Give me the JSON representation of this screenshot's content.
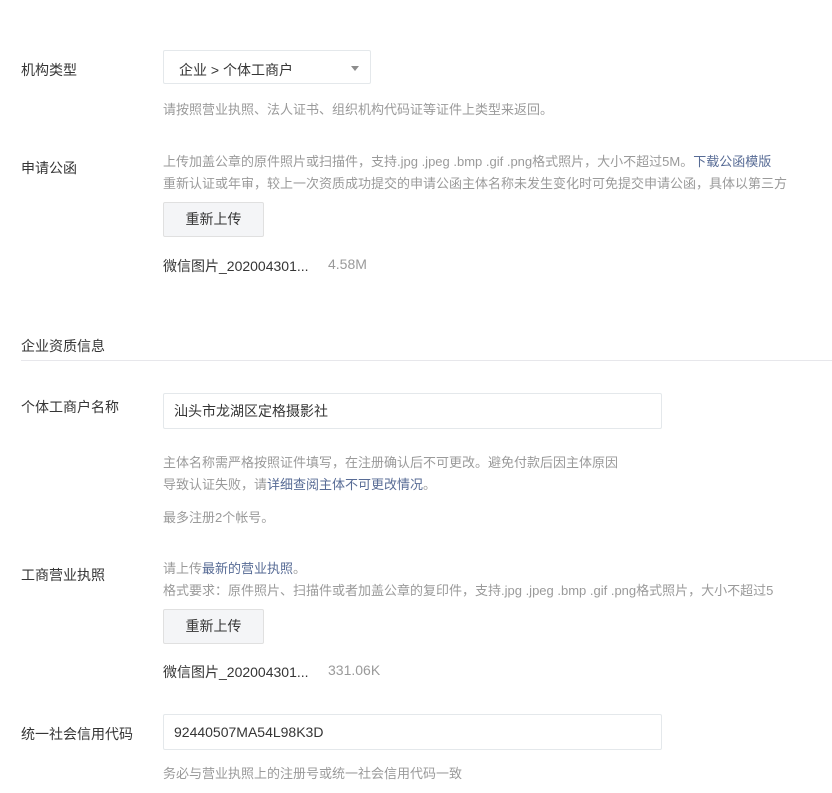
{
  "org_type": {
    "label": "机构类型",
    "value": "企业 > 个体工商户",
    "hint": "请按照营业执照、法人证书、组织机构代码证等证件上类型来返回。"
  },
  "application_letter": {
    "label": "申请公函",
    "hint_line1": "上传加盖公章的原件照片或扫描件，支持.jpg .jpeg .bmp .gif .png格式照片，大小不超过5M。",
    "download_link": "下载公函模版",
    "hint_line2": "重新认证或年审，较上一次资质成功提交的申请公函主体名称未发生变化时可免提交申请公函，具体以第三方",
    "reupload_button": "重新上传",
    "file_name": "微信图片_202004301...",
    "file_size": "4.58M"
  },
  "section": {
    "title": "企业资质信息"
  },
  "business_name": {
    "label": "个体工商户名称",
    "value": "汕头市龙湖区定格摄影社",
    "hint_line1": "主体名称需严格按照证件填写，在注册确认后不可更改。避免付款后因主体原因",
    "hint_line2_prefix": "导致认证失败，请",
    "hint_line2_link": "详细查阅主体不可更改情况",
    "hint_line2_suffix": "。",
    "limit_note": "最多注册2个帐号。"
  },
  "business_license": {
    "label": "工商营业执照",
    "hint_prefix": "请上传",
    "hint_link": "最新的营业执照",
    "hint_suffix": "。",
    "format_hint": "格式要求：原件照片、扫描件或者加盖公章的复印件，支持.jpg .jpeg .bmp .gif .png格式照片，大小不超过5",
    "reupload_button": "重新上传",
    "file_name": "微信图片_202004301...",
    "file_size": "331.06K"
  },
  "credit_code": {
    "label": "统一社会信用代码",
    "value": "92440507MA54L98K3D",
    "hint": "务必与营业执照上的注册号或统一社会信用代码一致"
  }
}
